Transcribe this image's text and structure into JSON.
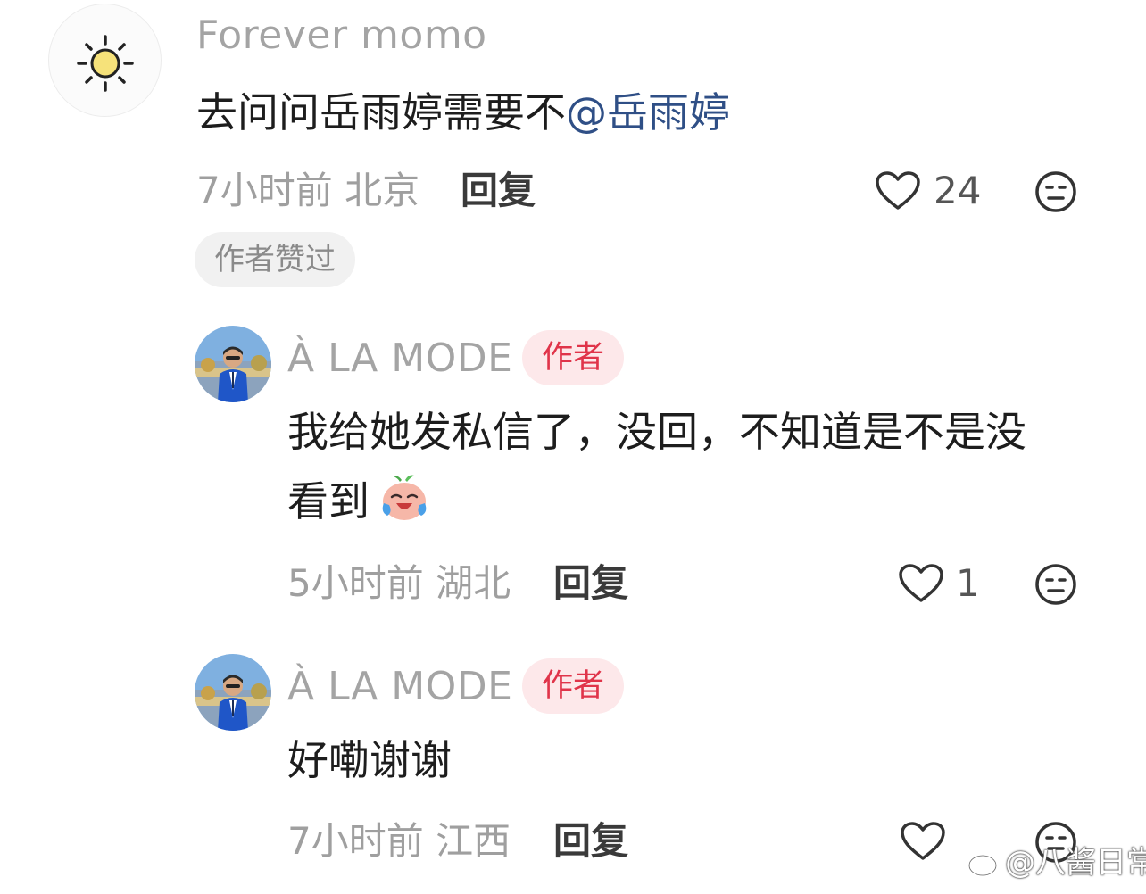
{
  "comments": [
    {
      "username": "Forever momo",
      "text_before_mention": "去问问岳雨婷需要不",
      "mention": "@岳雨婷",
      "time_location": "7小时前 北京",
      "reply_label": "回复",
      "likes": "24",
      "author_liked_tag": "作者赞过"
    }
  ],
  "replies": [
    {
      "username": "À LA MODE",
      "badge": "作者",
      "text_line1": "我给她发私信了，没回，不知道是不是没",
      "text_line2": "看到",
      "emoji": "crying-laughing-peach-emoji",
      "time_location": "5小时前 湖北",
      "reply_label": "回复",
      "likes": "1"
    },
    {
      "username": "À LA MODE",
      "badge": "作者",
      "text_line1": "好嘞谢谢",
      "time_location": "7小时前 江西",
      "reply_label": "回复",
      "likes": ""
    }
  ],
  "watermark": "@八酱日常",
  "colors": {
    "badge_bg": "#fde8ea",
    "badge_text": "#e0344a",
    "mention": "#2f4f86",
    "meta_text": "#9f9f9f"
  },
  "icons": [
    "sun-icon",
    "heart-icon",
    "dislike-face-icon",
    "weibo-logo-icon"
  ]
}
